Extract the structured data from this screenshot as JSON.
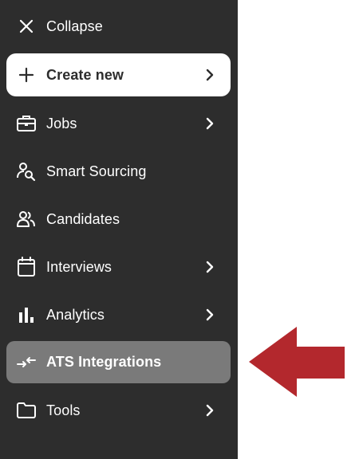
{
  "sidebar": {
    "collapse_label": "Collapse",
    "create_label": "Create new",
    "items": [
      {
        "label": "Jobs",
        "icon": "briefcase-icon"
      },
      {
        "label": "Smart Sourcing",
        "icon": "person-search-icon"
      },
      {
        "label": "Candidates",
        "icon": "people-icon"
      },
      {
        "label": "Interviews",
        "icon": "calendar-icon"
      },
      {
        "label": "Analytics",
        "icon": "bar-chart-icon"
      },
      {
        "label": "ATS Integrations",
        "icon": "sync-arrows-icon"
      },
      {
        "label": "Tools",
        "icon": "folder-icon"
      }
    ]
  },
  "colors": {
    "sidebar_bg": "#2d2d2d",
    "active_bg": "#7a7a7a",
    "annotation_arrow": "#b3282d"
  }
}
